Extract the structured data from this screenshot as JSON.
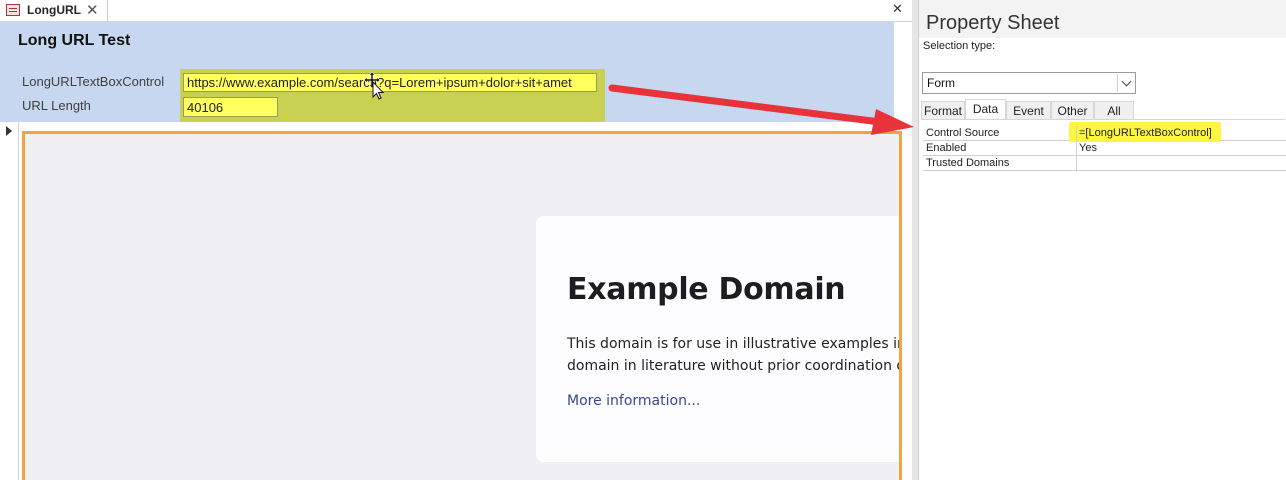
{
  "document_tab": {
    "label": "LongURL",
    "close_glyph": "✕"
  },
  "form": {
    "close_glyph": "✕",
    "title": "Long URL Test",
    "fields": {
      "url_label": "LongURLTextBoxControl",
      "url_value": "https://www.example.com/search?q=Lorem+ipsum+dolor+sit+amet",
      "length_label": "URL Length",
      "length_value": "40106"
    }
  },
  "browser": {
    "heading": "Example Domain",
    "line1": "This domain is for use in illustrative examples in documents. You may use this",
    "line2": "domain in literature without prior coordination or asking for permission.",
    "link": "More information..."
  },
  "property_sheet": {
    "title": "Property Sheet",
    "selection_type_label": "Selection type:",
    "selected_object": "Form",
    "tabs": [
      "Format",
      "Data",
      "Event",
      "Other",
      "All"
    ],
    "active_tab": "Data",
    "rows": [
      {
        "name": "Control Source",
        "value": "=[LongURLTextBoxControl]",
        "highlighted": true
      },
      {
        "name": "Enabled",
        "value": "Yes"
      },
      {
        "name": "Trusted Domains",
        "value": ""
      }
    ]
  },
  "colors": {
    "form_header": "#c6d7ef",
    "field_highlight": "#ffff5e",
    "group_highlight": "#c9d152",
    "annotation_arrow": "#e8333a",
    "browser_border": "#f0a441"
  },
  "icons": [
    "form-icon",
    "close-icon",
    "move-cursor-icon",
    "record-selector-arrow-icon",
    "chevron-down-icon",
    "annotation-arrow-icon"
  ]
}
